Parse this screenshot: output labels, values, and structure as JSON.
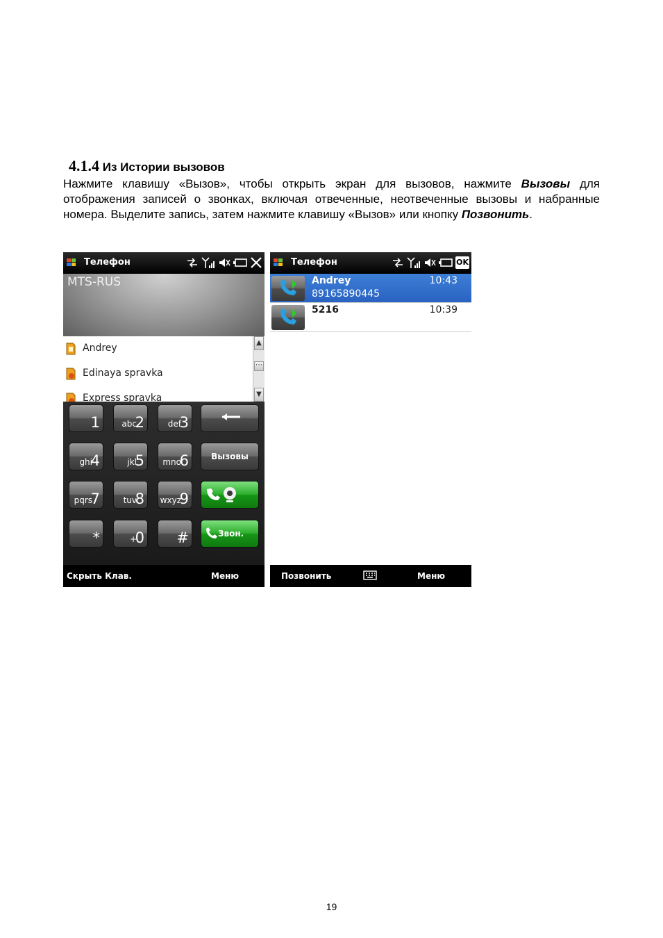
{
  "section": {
    "number": "4.1.4",
    "title": "Из Истории вызовов"
  },
  "paragraph": {
    "part1": "Нажмите клавишу «Вызов», чтобы открыть экран для вызовов, нажмите ",
    "bold1": "Вызовы",
    "part2": " для отображения записей о звонках, включая отвеченные, неотвеченные вызовы и набранные номера. Выделите запись, затем нажмите клавишу «Вызов» или кнопку ",
    "bold2": "Позвонить",
    "part3": "."
  },
  "page_number": "19",
  "screen1": {
    "title": "Телефон",
    "carrier": "MTS-RUS",
    "contacts": [
      "Andrey",
      "Edinaya spravka",
      "Express spravka"
    ],
    "keys": [
      {
        "sub": "",
        "main": "1"
      },
      {
        "sub": "abc",
        "main": "2"
      },
      {
        "sub": "def",
        "main": "3"
      },
      {
        "sub": "ghi",
        "main": "4"
      },
      {
        "sub": "jkl",
        "main": "5"
      },
      {
        "sub": "mno",
        "main": "6"
      },
      {
        "sub": "pqrs",
        "main": "7"
      },
      {
        "sub": "tuv",
        "main": "8"
      },
      {
        "sub": "wxyz",
        "main": "9"
      },
      {
        "sub": "",
        "main": "*"
      },
      {
        "sub": "+",
        "main": "0"
      },
      {
        "sub": "",
        "main": "#"
      }
    ],
    "calls_key": "Вызовы",
    "call_key": "Звон.",
    "softkeys": {
      "left": "Скрыть Клав.",
      "right": "Меню"
    }
  },
  "screen2": {
    "title": "Телефон",
    "ok_label": "OK",
    "records": [
      {
        "name": "Andrey",
        "number": "89165890445",
        "time": "10:43"
      },
      {
        "name": "5216",
        "number": "",
        "time": "10:39"
      }
    ],
    "softkeys": {
      "left": "Позвонить",
      "right": "Меню"
    }
  },
  "colors": {
    "selection": "#2f6fd0",
    "call_green": "#1aa01a",
    "dark": "#000000"
  }
}
